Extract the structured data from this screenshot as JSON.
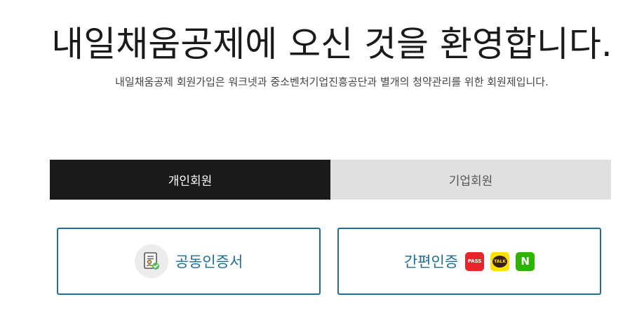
{
  "header": {
    "title": "내일채움공제에 오신 것을 환영합니다.",
    "subtitle": "내일채움공제 회원가입은 워크넷과 중소벤처기업진흥공단과 별개의 청약관리를 위한 회원제입니다."
  },
  "tabs": [
    {
      "label": "개인회원",
      "active": true
    },
    {
      "label": "기업회원",
      "active": false
    }
  ],
  "auth": {
    "certificate_label": "공동인증서",
    "certificate_icon": "certificate-icon",
    "simple_label": "간편인증",
    "providers": {
      "pass": "PASS",
      "kakao": "TALK",
      "naver": "N"
    }
  },
  "colors": {
    "accent": "#1f6f94",
    "tab_active_bg": "#1a1a1a",
    "tab_inactive_bg": "#e0e0e0",
    "pass": "#e8252a",
    "kakao": "#ffe100",
    "naver": "#2db400"
  }
}
